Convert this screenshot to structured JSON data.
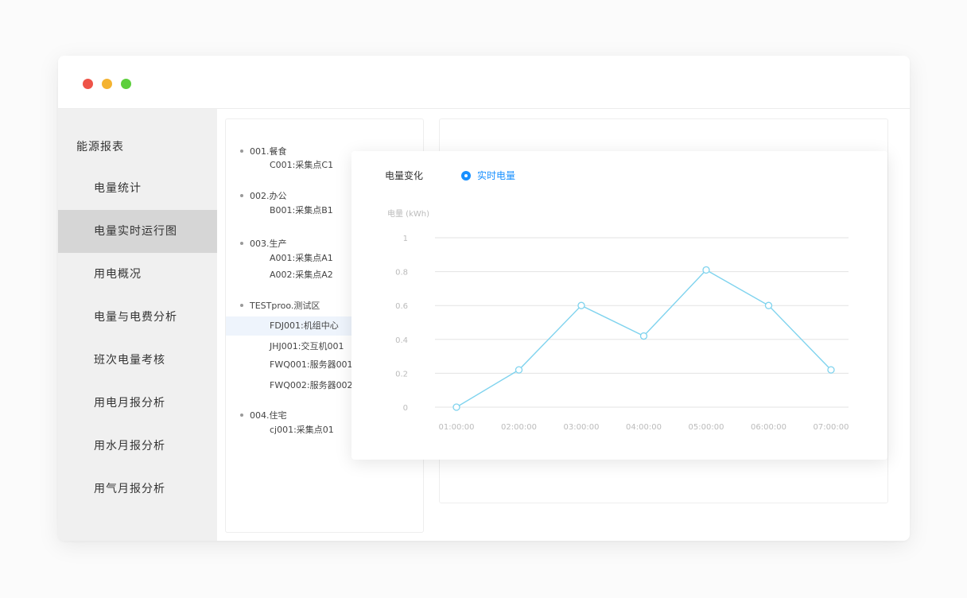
{
  "window": {
    "controls": {
      "close_color": "#ee5348",
      "minimize_color": "#f4b331",
      "maximize_color": "#5ccf3c"
    }
  },
  "sidebar": {
    "title": "能源报表",
    "active_index": 1,
    "items": [
      {
        "label": "电量统计"
      },
      {
        "label": "电量实时运行图"
      },
      {
        "label": "用电概况"
      },
      {
        "label": "电量与电费分析"
      },
      {
        "label": "班次电量考核"
      },
      {
        "label": "用电月报分析"
      },
      {
        "label": "用水月报分析"
      },
      {
        "label": "用气月报分析"
      }
    ]
  },
  "tree": {
    "groups": [
      {
        "label": "001.餐食",
        "children": [
          "C001:采集点C1"
        ]
      },
      {
        "label": "002.办公",
        "children": [
          "B001:采集点B1"
        ]
      },
      {
        "label": "003.生产",
        "children": [
          "A001:采集点A1",
          "A002:采集点A2"
        ]
      },
      {
        "label": "TESTproo.测试区",
        "children": [
          "FDJ001:机组中心",
          "JHJ001:交互机001",
          "FWQ001:服务器001",
          "FWQ002:服务器002"
        ]
      },
      {
        "label": "004.住宅",
        "children": [
          "cj001:采集点01"
        ]
      }
    ],
    "selected_leaf": "FDJ001:机组中心"
  },
  "chart_panel": {
    "tabs": [
      {
        "label": "电量变化",
        "active": false
      },
      {
        "label": "实时电量",
        "active": true
      }
    ],
    "accent_color": "#1890ff"
  },
  "chart_data": {
    "type": "line",
    "ylabel": "电量 (kWh)",
    "ylim": [
      0,
      1
    ],
    "yticks": [
      "0",
      "0.2",
      "0.4",
      "0.6",
      "0.8",
      "1"
    ],
    "categories": [
      "01:00:00",
      "02:00:00",
      "03:00:00",
      "04:00:00",
      "05:00:00",
      "06:00:00",
      "07:00:00"
    ],
    "series": [
      {
        "values": [
          0,
          0.22,
          0.6,
          0.42,
          0.81,
          0.6,
          0.22
        ],
        "color": "#7fd3ee"
      }
    ],
    "grid": true,
    "legend": "none"
  }
}
